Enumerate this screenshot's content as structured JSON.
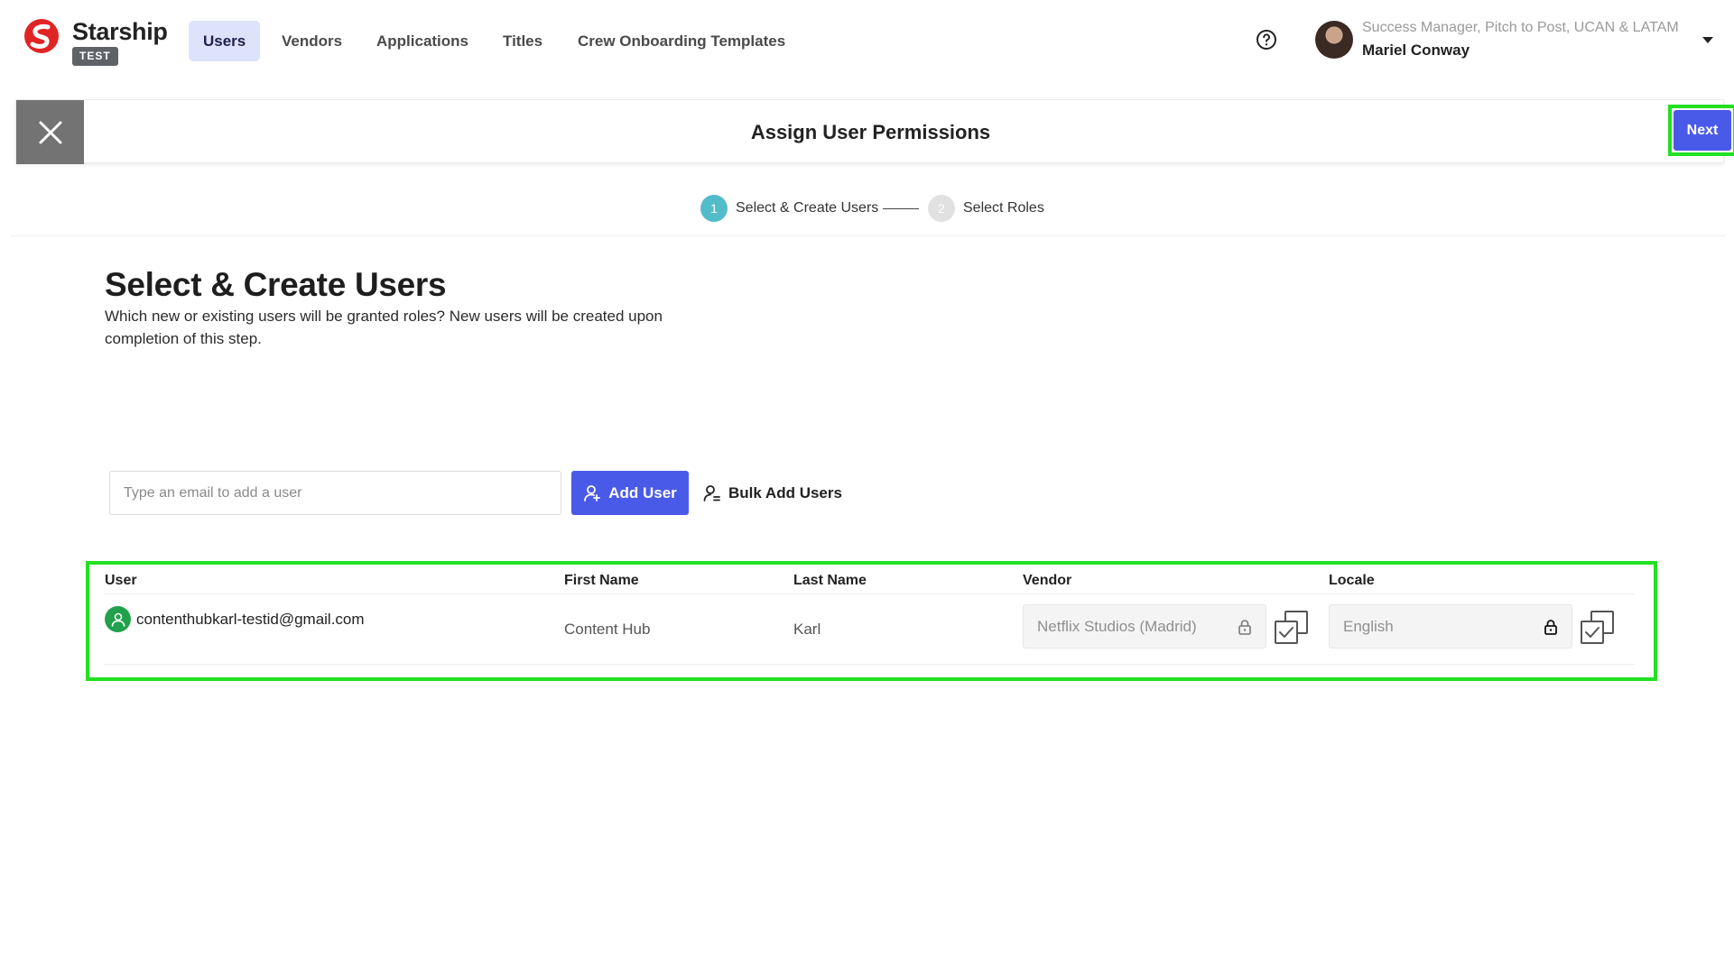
{
  "app": {
    "brand": "Starship",
    "env_badge": "TEST"
  },
  "nav": {
    "tabs": [
      {
        "label": "Users",
        "active": true
      },
      {
        "label": "Vendors",
        "active": false
      },
      {
        "label": "Applications",
        "active": false
      },
      {
        "label": "Titles",
        "active": false
      },
      {
        "label": "Crew Onboarding Templates",
        "active": false
      }
    ]
  },
  "user_menu": {
    "role": "Success Manager, Pitch to Post, UCAN & LATAM",
    "name": "Mariel Conway"
  },
  "header": {
    "title": "Assign User Permissions",
    "next_label": "Next"
  },
  "stepper": {
    "steps": [
      {
        "number": "1",
        "label": "Select & Create Users",
        "state": "active"
      },
      {
        "number": "2",
        "label": "Select Roles",
        "state": "pending"
      }
    ]
  },
  "main": {
    "heading": "Select & Create Users",
    "description": "Which new or existing users will be granted roles? New users will be created upon completion of this step."
  },
  "add_user": {
    "placeholder": "Type an email to add a user",
    "value": "",
    "add_label": "Add User",
    "bulk_label": "Bulk Add Users"
  },
  "table": {
    "columns": [
      "User",
      "First Name",
      "Last Name",
      "Vendor",
      "Locale"
    ],
    "rows": [
      {
        "email": "contenthubkarl-testid@gmail.com",
        "first_name": "Content Hub",
        "last_name": "Karl",
        "vendor": "Netflix Studios (Madrid)",
        "locale": "English"
      }
    ]
  },
  "colors": {
    "primary": "#4a5ae8",
    "active_tab_bg": "#dde3fb",
    "step_active": "#52bcc9",
    "highlight_outline": "#22e022",
    "user_icon_bg": "#21a14b",
    "brand_red": "#e02424"
  },
  "icons": {
    "logo": "starship-logo-icon",
    "help": "help-circle-icon",
    "close": "close-icon",
    "add_user": "user-plus-icon",
    "bulk": "users-list-icon",
    "lock": "lock-icon",
    "apply_all": "copy-check-icon",
    "user": "user-icon"
  }
}
